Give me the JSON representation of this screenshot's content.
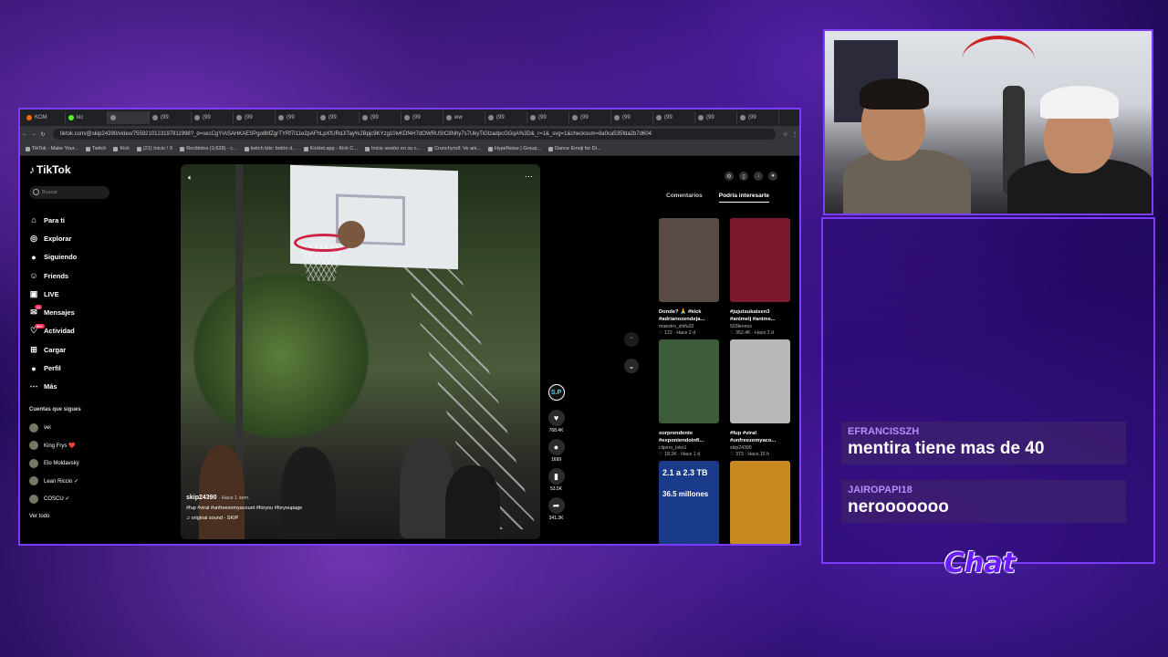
{
  "browser": {
    "tabs": [
      "KOM",
      "kic",
      "",
      "(99",
      "(99",
      "(99",
      "(99",
      "(99",
      "(99",
      "(99",
      "ww",
      "(99",
      "(99",
      "(99",
      "(99",
      "(99",
      "(99",
      "(99"
    ],
    "url": "tiktok.com/@skip24390/video/7559210123197811998?_d=secCgYIASAHKAESPgo8bfZgrTYRf7i11e2pAFhLpXfURdJiTay%2Bpjc9KYzg10lvKDf4H7dOWRUSIC8Nhy7s7UkyTiGlzadpcGGqA%3D&_r=1&_svg=1&checksum=8a0ca535fda2b7d604",
    "bookmarks": [
      "TikTok - Make Your...",
      "Twitch",
      "Kick",
      "(21) Inicio / X",
      "Recibidos (3,628) - c...",
      "twitch bits: botón d...",
      "Kicklet.app - Kick C...",
      "Inicie sesión en su c...",
      "Crunchyroll: Ve ani...",
      "HypeNoise | Group...",
      "Dance Emoji for Di..."
    ]
  },
  "tiktok": {
    "logo": "TikTok",
    "search_placeholder": "Buscar",
    "nav": [
      {
        "label": "Para ti",
        "icon": "home-icon"
      },
      {
        "label": "Explorar",
        "icon": "compass-icon"
      },
      {
        "label": "Siguiendo",
        "icon": "following-avatar-icon"
      },
      {
        "label": "Friends",
        "icon": "friends-icon"
      },
      {
        "label": "LIVE",
        "icon": "live-icon"
      },
      {
        "label": "Mensajes",
        "icon": "messages-icon",
        "badge": "11"
      },
      {
        "label": "Actividad",
        "icon": "activity-icon",
        "badge": "99+"
      },
      {
        "label": "Cargar",
        "icon": "upload-icon"
      },
      {
        "label": "Perfil",
        "icon": "profile-icon"
      },
      {
        "label": "Más",
        "icon": "more-icon"
      }
    ],
    "following_title": "Cuentas que sigues",
    "following": [
      "vei",
      "King Frys ❤️",
      "Elo Moldavsky",
      "Lean Riccio ✓",
      "COSCU ✓",
      "Ver todo"
    ],
    "video": {
      "username": "skip24390",
      "time": "· Hace 1 sem.",
      "hashtags": "#fup #viral #unfreezemyacount #foryou #foryoupage",
      "sound": "original sound - SKIP"
    },
    "actions": {
      "likes": "768.4K",
      "comments": "1699",
      "saves": "53.5K",
      "shares": "341.3K",
      "creator_initial": "S.P"
    },
    "right_tabs": [
      "Comentarios",
      "Podría interesarte"
    ],
    "cards": [
      {
        "title": "Donde? 🙏 #kick #adrianozendeja...",
        "author": "maestro_shifu32",
        "meta": "♡ 122 · Hace 2 d",
        "thumb": "#5a4a46"
      },
      {
        "title": "#jujutsukaisen3 #animelj #anime...",
        "author": "503lennox",
        "meta": "♡ 352.4K · Hace 2 d",
        "thumb": "#7a1a2a"
      },
      {
        "title": "sorprendente #exponiendoinfi...",
        "author": "clipero_loko1",
        "meta": "♡ 18.2K · Hace 1 d",
        "thumb": "#3c5c3a"
      },
      {
        "title": "#fup #viral #unfreezemyaco...",
        "author": "skip24390",
        "meta": "♡ 373 · Hace 15 h",
        "thumb": "#b8b8b8"
      },
      {
        "title": "",
        "author": "",
        "meta": "",
        "thumb": "#1a3a8a",
        "overlay1": "2.1 a 2.3 TB",
        "overlay2": "36.5 millones"
      },
      {
        "title": "",
        "author": "",
        "meta": "",
        "thumb": "#c88a20"
      }
    ]
  },
  "chat": {
    "messages": [
      {
        "user": "EFRANCISSZH",
        "text": "mentira tiene mas de 40"
      },
      {
        "user": "JAIROPAPI18",
        "text": "nerooooooo"
      }
    ],
    "label": "Chat"
  },
  "colors": {
    "accent": "#7b3cff",
    "tiktok_red": "#fe2c55",
    "chat_user": "#b68cff"
  }
}
